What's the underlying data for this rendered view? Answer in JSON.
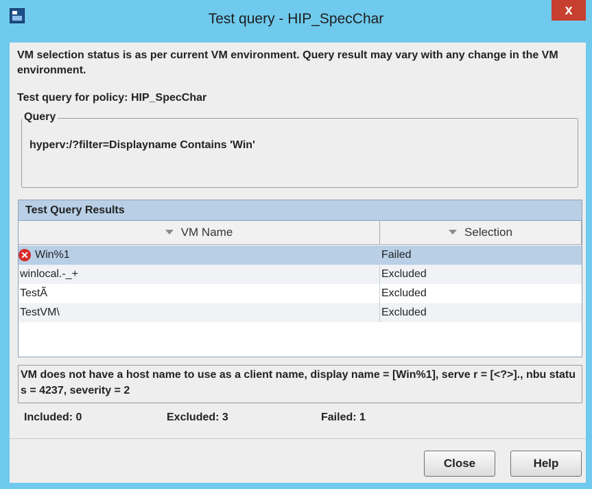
{
  "window": {
    "title": "Test query - HIP_SpecChar",
    "close_label": "x"
  },
  "message": "VM selection status is as per current VM environment. Query result may vary with any change in the VM environment.",
  "policy_label": "Test query for policy: HIP_SpecChar",
  "query": {
    "legend": "Query",
    "text": "hyperv:/?filter=Displayname Contains 'Win'"
  },
  "results": {
    "header": "Test Query Results",
    "columns": [
      "VM Name",
      "Selection"
    ],
    "rows": [
      {
        "name": "Win%1",
        "selection": "Failed",
        "icon": "error-icon",
        "selected": true
      },
      {
        "name": "winlocal.-_+",
        "selection": "Excluded"
      },
      {
        "name": "TestÃ",
        "selection": "Excluded"
      },
      {
        "name": "TestVM\\",
        "selection": "Excluded"
      }
    ]
  },
  "status_message": "VM does not have a host name to use as a client name, display name = [Win%1], serve r = [<?>]., nbu status = 4237, severity = 2",
  "counts": {
    "included": "Included: 0",
    "excluded": "Excluded: 3",
    "failed": "Failed: 1"
  },
  "buttons": {
    "close": "Close",
    "help": "Help"
  },
  "colors": {
    "titlebar": "#6fcaed",
    "selected_row": "#b8cfe6",
    "close_button": "#c7402f",
    "error_icon": "#d62b2b"
  }
}
